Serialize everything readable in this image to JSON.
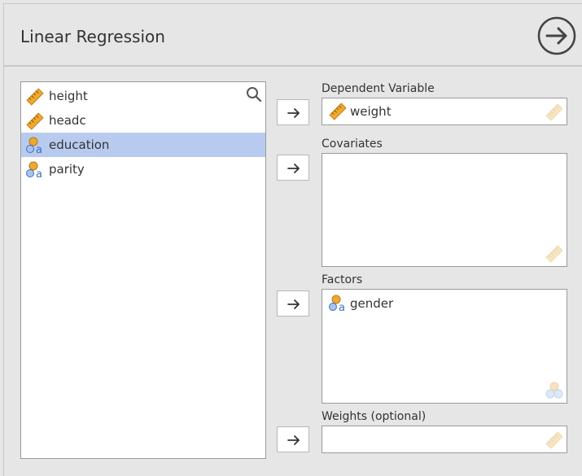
{
  "header": {
    "title": "Linear Regression",
    "run_icon": "arrow-right-circle-icon"
  },
  "variables": [
    {
      "label": "height",
      "icon": "ruler-icon",
      "selected": false
    },
    {
      "label": "headc",
      "icon": "ruler-icon",
      "selected": false
    },
    {
      "label": "education",
      "icon": "nominal-icon",
      "selected": true
    },
    {
      "label": "parity",
      "icon": "nominal-icon",
      "selected": false
    }
  ],
  "targets": {
    "dependent": {
      "label": "Dependent Variable",
      "items": [
        "weight"
      ]
    },
    "covariates": {
      "label": "Covariates",
      "items": []
    },
    "factors": {
      "label": "Factors",
      "items": [
        "gender"
      ]
    },
    "weights": {
      "label": "Weights (optional)",
      "items": []
    }
  },
  "colors": {
    "selected_row": "#b8cbef",
    "ruler": "#f0a830",
    "nominal_circle": "#f0a830",
    "nominal_a": "#3a6fc4"
  }
}
